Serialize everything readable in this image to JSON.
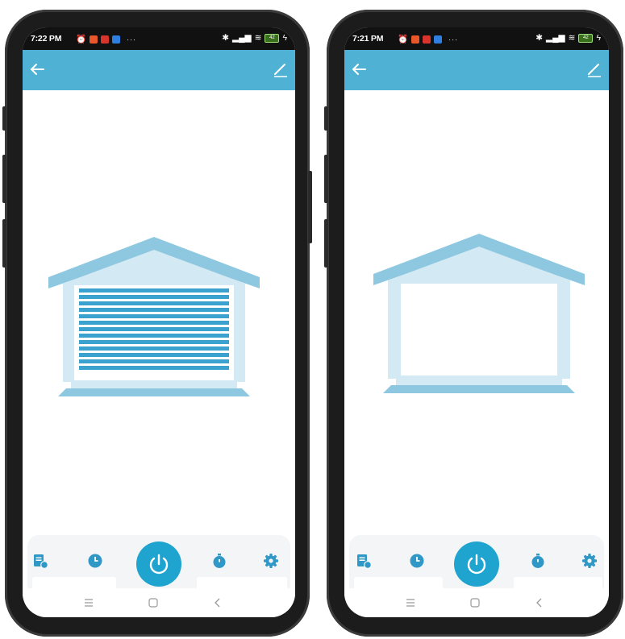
{
  "colors": {
    "accent": "#4fb2d4",
    "power": "#1fa4d0",
    "door": "#3ba2cf",
    "house_light": "#d3e9f3",
    "house_mid": "#8ec8e0"
  },
  "phones": [
    {
      "status": {
        "time": "7:22 PM",
        "more": "···",
        "battery": "42"
      },
      "door_state": "closed"
    },
    {
      "status": {
        "time": "7:21 PM",
        "more": "···",
        "battery": "42"
      },
      "door_state": "open"
    }
  ],
  "icons": {
    "back": "arrow-left-icon",
    "edit": "pencil-icon",
    "dock": [
      "log-icon",
      "schedule-icon",
      "power-icon",
      "timer-icon",
      "settings-icon"
    ],
    "nav": [
      "menu-icon",
      "home-icon",
      "back-chevron-icon"
    ]
  }
}
